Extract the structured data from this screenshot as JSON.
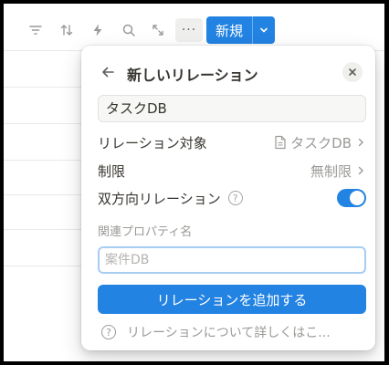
{
  "toolbar": {
    "icons": [
      "filter-icon",
      "sort-icon",
      "automation-bolt-icon",
      "search-icon",
      "expand-icon",
      "more-icon"
    ],
    "more_label": "···",
    "new_label": "新規"
  },
  "popup": {
    "title": "新しいリレーション",
    "name_value": "タスクDB",
    "rows": [
      {
        "label": "リレーション対象",
        "value": "タスクDB"
      },
      {
        "label": "制限",
        "value": "無制限"
      },
      {
        "label": "双方向リレーション",
        "toggle_on": true
      }
    ],
    "help_glyph": "?",
    "related_property_label": "関連プロパティ名",
    "related_property_placeholder": "案件DB",
    "related_property_value": "",
    "cta_label": "リレーションを追加する",
    "learn_more": "リレーションについて詳しくはこ..."
  },
  "colors": {
    "accent": "#2383e2",
    "text": "#37352f",
    "muted": "#9b9a97"
  }
}
